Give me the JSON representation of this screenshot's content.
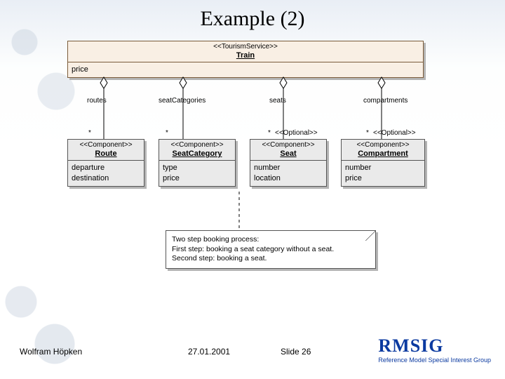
{
  "title": "Example (2)",
  "uml": {
    "main": {
      "stereo": "<<TourismService>>",
      "name": "Train",
      "attr1": "price"
    },
    "assoc": {
      "routes": {
        "role": "routes",
        "mult": "*",
        "constraint": ""
      },
      "categories": {
        "role": "seatCategories",
        "mult": "*",
        "constraint": ""
      },
      "seats": {
        "role": "seats",
        "mult": "*",
        "constraint": "<<Optional>>"
      },
      "compartments": {
        "role": "compartments",
        "mult": "*",
        "constraint": "<<Optional>>"
      }
    },
    "comp": {
      "route": {
        "stereo": "<<Component>>",
        "name": "Route",
        "a1": "departure",
        "a2": "destination"
      },
      "seatcat": {
        "stereo": "<<Component>>",
        "name": "SeatCategory",
        "a1": "type",
        "a2": "price"
      },
      "seat": {
        "stereo": "<<Component>>",
        "name": "Seat",
        "a1": "number",
        "a2": "location"
      },
      "compartment": {
        "stereo": "<<Component>>",
        "name": "Compartment",
        "a1": "number",
        "a2": "price"
      }
    },
    "note": {
      "l1": "Two step booking process:",
      "l2": "First step: booking a seat category without a seat.",
      "l3": "Second step: booking a seat."
    }
  },
  "footer": {
    "author": "Wolfram Höpken",
    "date": "27.01.2001",
    "slide": "Slide 26",
    "brand": "RMSIG",
    "brand_sub": "Reference Model Special Interest Group"
  }
}
